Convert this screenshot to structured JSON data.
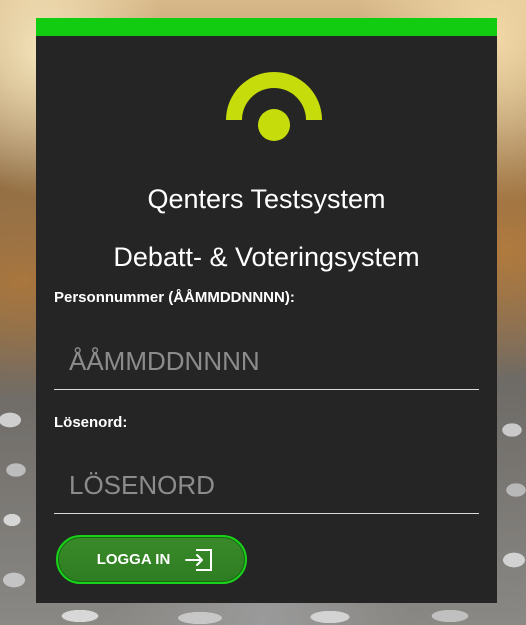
{
  "colors": {
    "accent_green": "#12cc12",
    "logo_yellow": "#c6dc0b",
    "panel_bg": "#252525",
    "button_bg": "#2e7d22"
  },
  "header": {
    "title": "Qenters Testsystem",
    "subtitle": "Debatt- & Voteringsystem"
  },
  "form": {
    "personnummer_label": "Personnummer (ÅÅMMDDNNNN):",
    "personnummer_placeholder": "ÅÅMMDDNNNN",
    "password_label": "Lösenord:",
    "password_placeholder": "LÖSENORD",
    "login_label": "LOGGA IN"
  },
  "icons": {
    "logo": "signal-arc-logo-icon",
    "login": "sign-in-arrow-icon"
  }
}
